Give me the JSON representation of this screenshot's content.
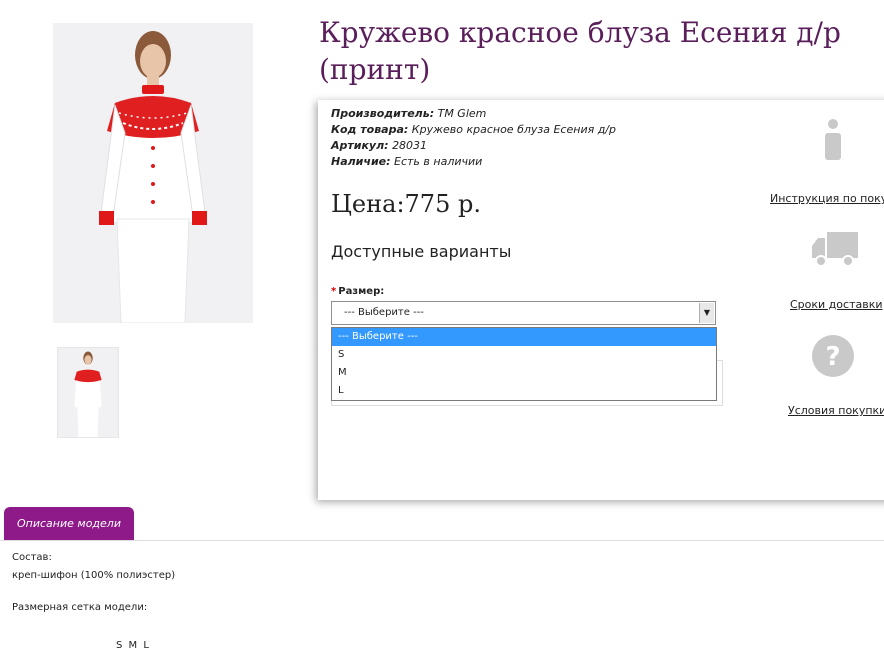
{
  "product": {
    "title": "Кружево красное блуза Есения д/р (принт)",
    "meta": {
      "manufacturer_label": "Производитель:",
      "manufacturer_value": "ТМ Glem",
      "code_label": "Код товара:",
      "code_value": "Кружево красное блуза Есения д/р",
      "article_label": "Артикул:",
      "article_value": "28031",
      "availability_label": "Наличие:",
      "availability_value": "Есть в наличии"
    },
    "price": "Цена:775 р.",
    "variants_title": "Доступные варианты",
    "size_label": "Размер:",
    "size_select": {
      "selected": "--- Выберите ---",
      "options": [
        "--- Выберите ---",
        "S",
        "M",
        "L"
      ]
    }
  },
  "side_links": {
    "instructions": "Инструкция по покуп",
    "delivery": "Сроки доставки",
    "terms": "Условия покупки"
  },
  "icons": {
    "info": "info-icon",
    "truck": "truck-icon",
    "question": "question-icon"
  },
  "tab": {
    "label": "Описание модели"
  },
  "description": {
    "composition_label": "Состав:",
    "composition_value": "креп-шифон (100% полиэстер)",
    "size_grid_label": "Размерная сетка модели:",
    "sizes_row": "S M L"
  },
  "colors": {
    "title": "#5a1f5a",
    "tab": "#8e1a8a",
    "dropdown_highlight": "#3399ff"
  }
}
